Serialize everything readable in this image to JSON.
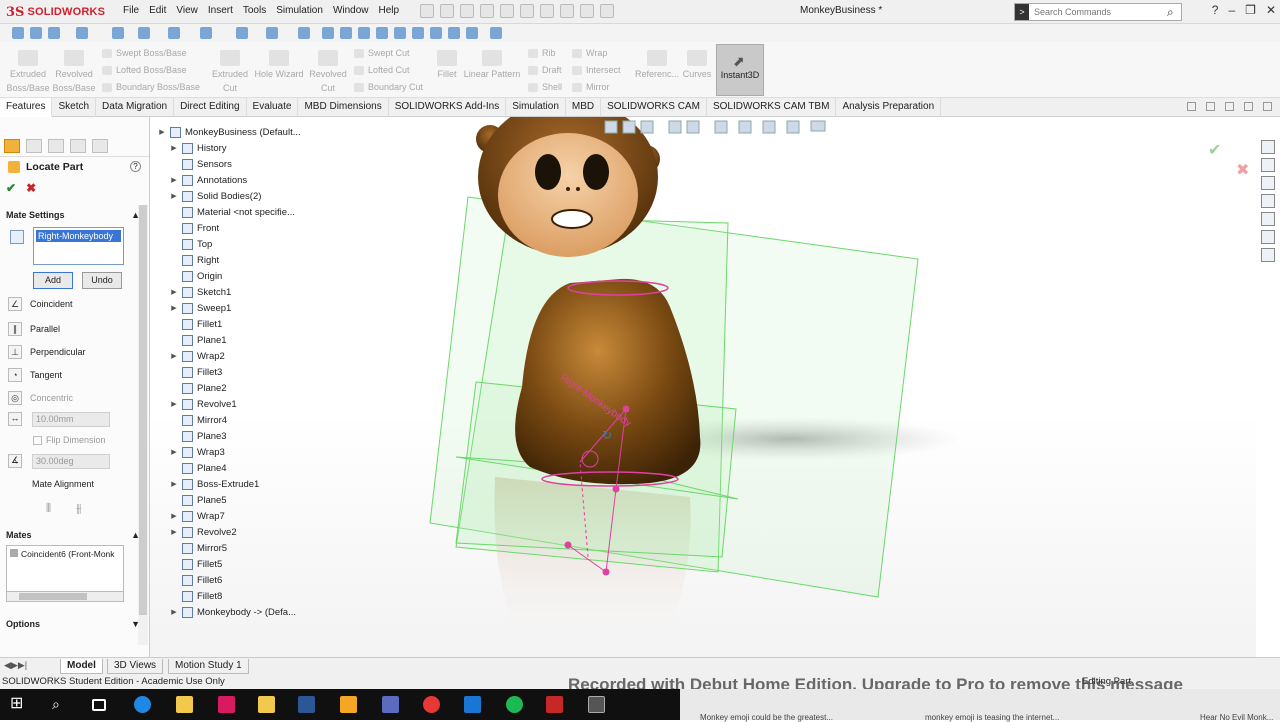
{
  "app": {
    "brand_prefix": "3S",
    "brand": "SOLIDWORKS",
    "document_title": "MonkeyBusiness *",
    "menu": [
      "File",
      "Edit",
      "View",
      "Insert",
      "Tools",
      "Simulation",
      "Window",
      "Help"
    ],
    "search_placeholder": "Search Commands"
  },
  "ribbon": {
    "extruded_boss": "Extruded Boss/Base",
    "revolved_boss": "Revolved Boss/Base",
    "swept_boss": "Swept Boss/Base",
    "lofted_boss": "Lofted Boss/Base",
    "boundary_boss": "Boundary Boss/Base",
    "extruded_cut": "Extruded Cut",
    "hole_wizard": "Hole Wizard",
    "revolved_cut": "Revolved Cut",
    "swept_cut": "Swept Cut",
    "lofted_cut": "Lofted Cut",
    "boundary_cut": "Boundary Cut",
    "fillet": "Fillet",
    "linear_pattern": "Linear Pattern",
    "rib": "Rib",
    "draft": "Draft",
    "shell": "Shell",
    "wrap": "Wrap",
    "intersect": "Intersect",
    "mirror": "Mirror",
    "reference": "Referenc...",
    "curves": "Curves",
    "instant3d": "Instant3D"
  },
  "tabs": [
    "Features",
    "Sketch",
    "Data Migration",
    "Direct Editing",
    "Evaluate",
    "MBD Dimensions",
    "SOLIDWORKS Add-Ins",
    "Simulation",
    "MBD",
    "SOLIDWORKS CAM",
    "SOLIDWORKS CAM TBM",
    "Analysis Preparation"
  ],
  "property_manager": {
    "title": "Locate Part",
    "ok": "✔",
    "cancel": "✖",
    "mate_settings_label": "Mate Settings",
    "selection": "Right-Monkeybody",
    "add_label": "Add",
    "undo_label": "Undo",
    "mate_types": [
      "Coincident",
      "Parallel",
      "Perpendicular",
      "Tangent",
      "Concentric"
    ],
    "distance_value": "10.00mm",
    "flip_dimension_label": "Flip Dimension",
    "angle_value": "30.00deg",
    "mate_alignment_label": "Mate Alignment",
    "mates_label": "Mates",
    "mates_list": [
      "Coincident6 (Front-Monk"
    ],
    "options_label": "Options"
  },
  "feature_tree": {
    "root": "MonkeyBusiness  (Default...",
    "items": [
      "History",
      "Sensors",
      "Annotations",
      "Solid Bodies(2)",
      "Material <not specifie...",
      "Front",
      "Top",
      "Right",
      "Origin",
      "Sketch1",
      "Sweep1",
      "Fillet1",
      "Plane1",
      "Wrap2",
      "Fillet3",
      "Plane2",
      "Revolve1",
      "Mirror4",
      "Plane3",
      "Wrap3",
      "Plane4",
      "Boss-Extrude1",
      "Plane5",
      "Wrap7",
      "Revolve2",
      "Mirror5",
      "Fillet5",
      "Fillet6",
      "Fillet8",
      "Monkeybody -> (Defa..."
    ]
  },
  "viewport": {
    "sketch_text": "Right-Monkeybody"
  },
  "bottom_tabs": [
    "Model",
    "3D Views",
    "Motion Study 1"
  ],
  "status": {
    "left": "SOLIDWORKS Student Edition - Academic Use Only",
    "right": "Editing Part",
    "watermark": "Recorded with Debut Home Edition. Upgrade to Pro to remove this message"
  },
  "taskbar": {
    "snippets": [
      "Monkey emoji could be the greatest...",
      "monkey emoji is teasing the internet...",
      "Hear No Evil Monk..."
    ]
  },
  "colors": {
    "brand_red": "#d1202f",
    "plane_green": "#6ad86a",
    "body_brown": "#7a4a12",
    "sketch_pink": "#e040a0"
  }
}
